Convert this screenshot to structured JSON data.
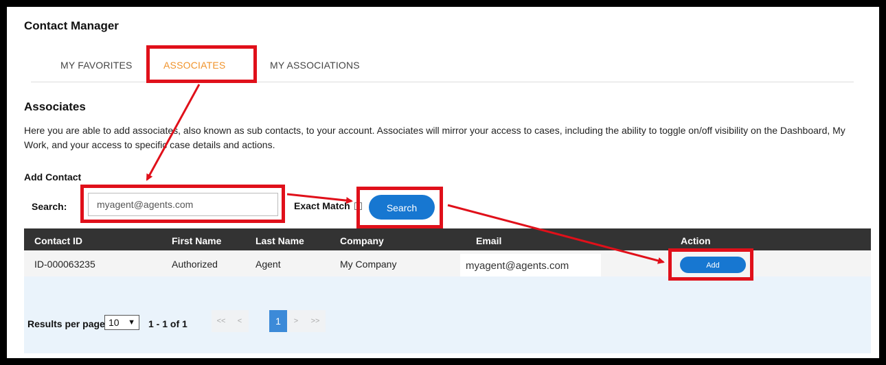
{
  "app": {
    "title": "Contact Manager"
  },
  "tabs": [
    {
      "label": "MY FAVORITES",
      "active": false
    },
    {
      "label": "ASSOCIATES",
      "active": true
    },
    {
      "label": "MY ASSOCIATIONS",
      "active": false
    }
  ],
  "section": {
    "title": "Associates",
    "description": "Here you are able to add associates, also known as sub contacts, to your account. Associates will mirror your access to cases, including the ability to toggle on/off visibility on the Dashboard, My Work, and your access to specific case details and actions."
  },
  "add_contact": {
    "label": "Add Contact",
    "search_label": "Search:",
    "search_value": "myagent@agents.com",
    "exact_match_label": "Exact Match",
    "exact_match_checked": false,
    "search_button": "Search"
  },
  "table": {
    "columns": [
      "Contact ID",
      "First Name",
      "Last Name",
      "Company",
      "Email",
      "Action"
    ],
    "rows": [
      {
        "contact_id": "ID-000063235",
        "first_name": "Authorized",
        "last_name": "Agent",
        "company": "My Company",
        "email": "myagent@agents.com",
        "action": "Add"
      }
    ]
  },
  "pagination": {
    "rpp_label": "Results per page",
    "rpp_value": "10",
    "range": "1 - 1 of 1",
    "first": "<<",
    "prev": "<",
    "current": "1",
    "next": ">",
    "last": ">>"
  },
  "colors": {
    "accent": "#1777d1",
    "active_tab": "#f0932b",
    "annotation": "#e0101a",
    "header_bg": "#333333"
  }
}
